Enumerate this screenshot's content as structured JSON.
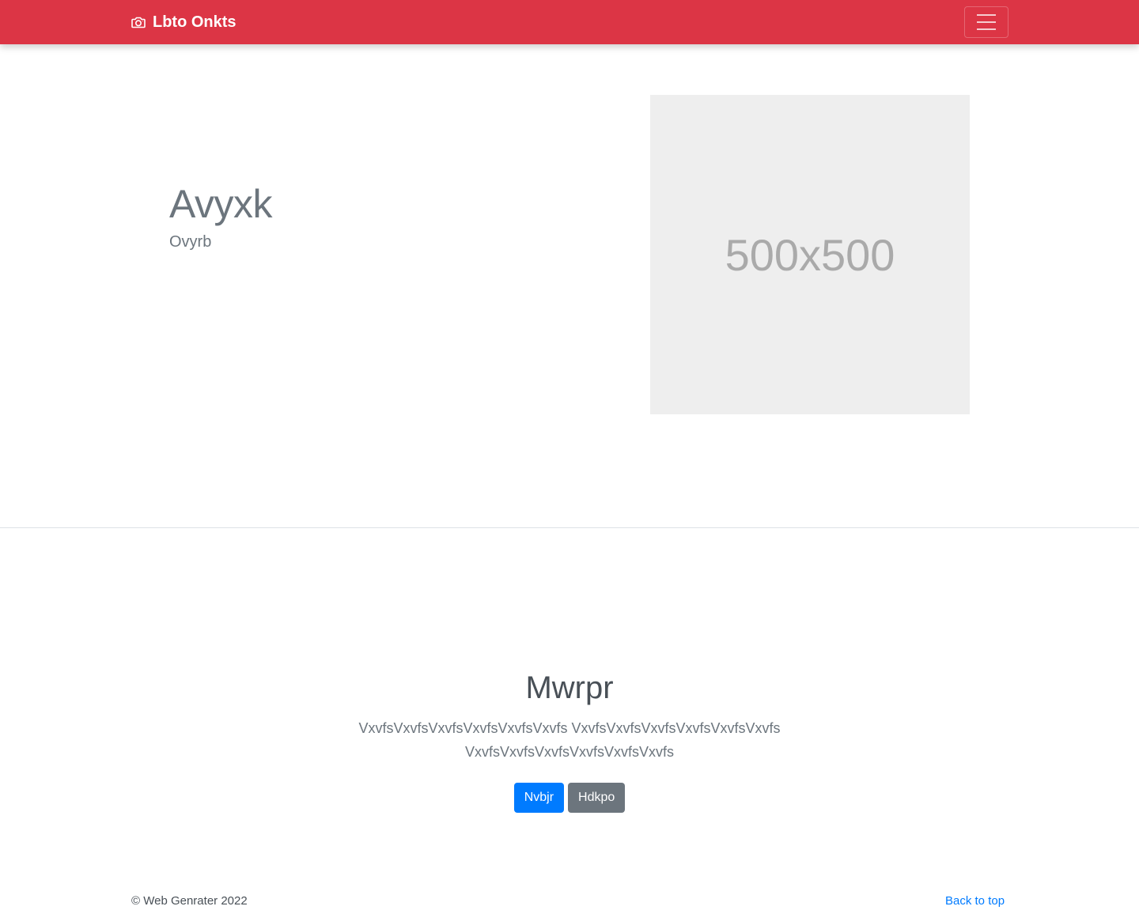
{
  "navbar": {
    "brand": "Lbto Onkts",
    "brand_icon": "camera-icon",
    "toggler_icon": "hamburger-menu-icon",
    "background": "#dc3545"
  },
  "hero": {
    "title": "Avyxk",
    "subtitle": "Ovyrb",
    "image_placeholder": "500x500"
  },
  "section": {
    "title": "Mwrpr",
    "text": "VxvfsVxvfsVxvfsVxvfsVxvfsVxvfs VxvfsVxvfsVxvfsVxvfsVxvfsVxvfs VxvfsVxvfsVxvfsVxvfsVxvfsVxvfs",
    "primary_button": "Nvbjr",
    "secondary_button": "Hdkpo"
  },
  "footer": {
    "copyright": "© Web Genrater 2022",
    "back_to_top": "Back to top"
  },
  "colors": {
    "primary": "#007bff",
    "secondary": "#6c757d",
    "danger": "#dc3545"
  }
}
